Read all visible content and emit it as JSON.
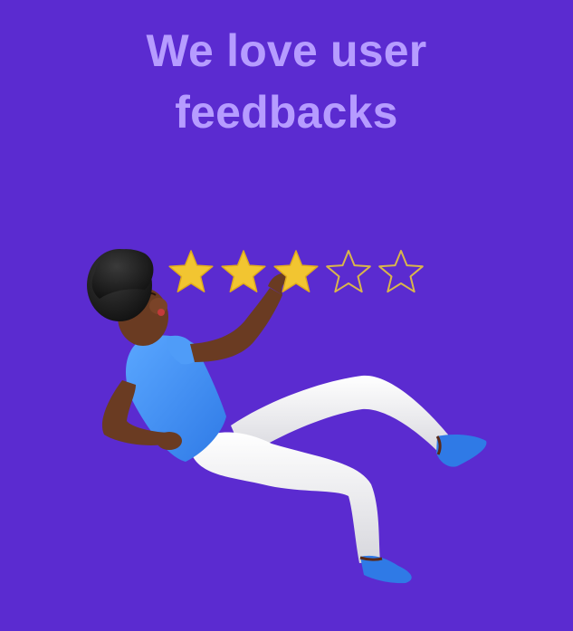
{
  "headline": {
    "line1": "We love user",
    "line2": "feedbacks"
  },
  "rating": {
    "value": 3,
    "max": 5
  },
  "colors": {
    "background": "#5b2bd0",
    "headline": "#b69cff",
    "star_filled": "#f2c531",
    "star_outline": "#d9b64a",
    "shirt": "#3d8ff0",
    "pants": "#ececec",
    "shoes": "#2f7ae6",
    "skin": "#6a3b22",
    "hair": "#1a1a1a"
  },
  "icons": {
    "star_filled": "star-filled-icon",
    "star_empty": "star-outline-icon"
  }
}
